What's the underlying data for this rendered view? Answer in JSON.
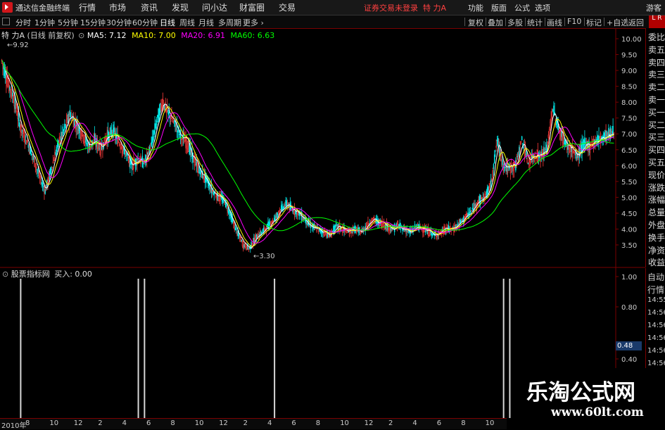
{
  "app": {
    "title": "通达信金融终端",
    "broker_status": "证券交易未登录",
    "stock_title": "特 力A"
  },
  "main_menu": [
    "行情",
    "市场",
    "资讯",
    "发现",
    "问小达",
    "财富圈",
    "交易"
  ],
  "right_menu": [
    "功能",
    "版面",
    "公式",
    "选项",
    "游客"
  ],
  "period_tabs": [
    {
      "label": "分时",
      "active": false
    },
    {
      "label": "1分钟",
      "active": false
    },
    {
      "label": "5分钟",
      "active": false
    },
    {
      "label": "15分钟",
      "active": false
    },
    {
      "label": "30分钟",
      "active": false
    },
    {
      "label": "60分钟",
      "active": false
    },
    {
      "label": "日线",
      "active": true
    },
    {
      "label": "周线",
      "active": false
    },
    {
      "label": "月线",
      "active": false
    },
    {
      "label": "多周期",
      "active": false
    },
    {
      "label": "更多",
      "active": false
    }
  ],
  "toolbar_buttons": [
    "复权",
    "叠加",
    "多股",
    "统计",
    "画线",
    "F10",
    "标记",
    "+自选",
    "返回"
  ],
  "lr_badge": "L R",
  "main_legend": {
    "stock": "特 力A",
    "mode": "(日线 前复权)",
    "ma5": "MA5: 7.12",
    "ma10": "MA10: 7.00",
    "ma20": "MA20: 6.91",
    "ma60": "MA60: 6.63"
  },
  "price_axis": [
    "10.00",
    "9.50",
    "9.00",
    "8.50",
    "8.00",
    "7.50",
    "7.00",
    "6.50",
    "6.00",
    "5.50",
    "5.00",
    "4.50",
    "4.00",
    "3.50"
  ],
  "annotations": {
    "high": "9.92",
    "low": "3.30"
  },
  "sidebar_items": [
    "委比",
    "卖五",
    "卖四",
    "卖三",
    "卖二",
    "卖一",
    "买一",
    "买二",
    "买三",
    "买四",
    "买五",
    "现价",
    "涨跌",
    "涨幅",
    "总量",
    "外盘",
    "换手",
    "净资",
    "收益"
  ],
  "sub_legend": {
    "name": "股票指标网",
    "series": "买入: 0.00"
  },
  "sub_axis": [
    "1.00",
    "0.80",
    "0.48",
    "0.40"
  ],
  "sub_highlight": "0.48",
  "sidebar2_items": [
    "自动",
    "行情",
    "14:55",
    "14:56",
    "14:56",
    "14:56",
    "14:56",
    "14:56",
    "14:56"
  ],
  "date_axis": [
    "2010年",
    "8",
    "10",
    "12",
    "2",
    "4",
    "6",
    "8",
    "10",
    "12",
    "2",
    "4",
    "6",
    "8",
    "10",
    "12",
    "2",
    "4",
    "6",
    "8",
    "10"
  ],
  "watermark": {
    "title": "乐淘公式网",
    "url": "www.60lt.com"
  },
  "colors": {
    "up": "#ff3c3c",
    "down": "#00e8e8",
    "ma5": "#ffffff",
    "ma10": "#ffff00",
    "ma20": "#ff00ff",
    "ma60": "#00ff00",
    "frame": "#7a0000"
  },
  "chart_data": {
    "type": "candlestick",
    "price_range": [
      3.3,
      10.0
    ],
    "closes": [
      9.3,
      8.6,
      8.1,
      7.2,
      6.8,
      6.3,
      5.7,
      5.2,
      5.9,
      6.6,
      7.1,
      7.6,
      7.3,
      7.0,
      6.6,
      6.8,
      6.5,
      6.9,
      7.1,
      6.7,
      6.4,
      6.0,
      6.2,
      6.1,
      6.5,
      7.4,
      8.0,
      7.6,
      7.3,
      6.9,
      6.7,
      6.2,
      5.8,
      5.6,
      5.2,
      5.0,
      4.9,
      4.4,
      3.9,
      3.5,
      3.4,
      3.7,
      3.9,
      4.1,
      4.3,
      4.6,
      4.8,
      4.6,
      4.5,
      4.3,
      4.1,
      4.0,
      3.9,
      3.8,
      4.1,
      4.0,
      3.9,
      4.0,
      3.9,
      4.1,
      4.3,
      4.2,
      4.1,
      4.0,
      4.1,
      4.0,
      3.9,
      4.1,
      4.0,
      3.9,
      3.8,
      3.9,
      4.0,
      4.0,
      4.2,
      4.4,
      4.6,
      4.9,
      5.0,
      5.4,
      6.8,
      6.0,
      5.9,
      6.0,
      6.8,
      6.1,
      6.3,
      6.3,
      6.5,
      7.8,
      7.1,
      6.7,
      6.5,
      6.3,
      6.7,
      6.6,
      6.8,
      6.9,
      7.0,
      7.1
    ],
    "signals": [
      3,
      22,
      23,
      44,
      81,
      82
    ],
    "signal_value": 1.0
  }
}
